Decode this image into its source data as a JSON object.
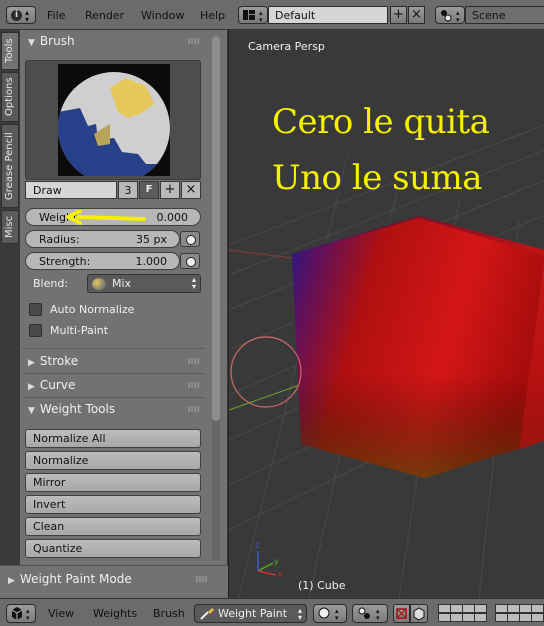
{
  "topbar": {
    "menus": [
      "File",
      "Render",
      "Window",
      "Help"
    ],
    "layout_name": "Default",
    "scene_name": "Scene"
  },
  "vtabs": [
    "Tools",
    "Options",
    "Grease Pencil",
    "Misc"
  ],
  "brush_panel": {
    "title": "Brush",
    "brush_name": "Draw",
    "users": "3",
    "fake_user": "F",
    "weight": {
      "label": "Weight",
      "value": "0.000"
    },
    "radius": {
      "label": "Radius:",
      "value": "35 px"
    },
    "strength": {
      "label": "Strength:",
      "value": "1.000"
    },
    "blend": {
      "label": "Blend:",
      "value": "Mix"
    },
    "auto_normalize": "Auto Normalize",
    "multi_paint": "Multi-Paint"
  },
  "collapsed_panels": {
    "stroke": "Stroke",
    "curve": "Curve"
  },
  "weight_tools": {
    "title": "Weight Tools",
    "buttons": [
      "Normalize All",
      "Normalize",
      "Mirror",
      "Invert",
      "Clean",
      "Quantize"
    ]
  },
  "mode_panel": {
    "title": "Weight Paint Mode"
  },
  "viewport": {
    "view_name": "Camera Persp",
    "object_name": "(1) Cube",
    "annotation_line1": "Cero le quita",
    "annotation_line2": "Uno le suma",
    "annotation_color": "#f7f000"
  },
  "bottombar": {
    "menus": [
      "View",
      "Weights",
      "Brush"
    ],
    "mode": "Weight Paint"
  }
}
